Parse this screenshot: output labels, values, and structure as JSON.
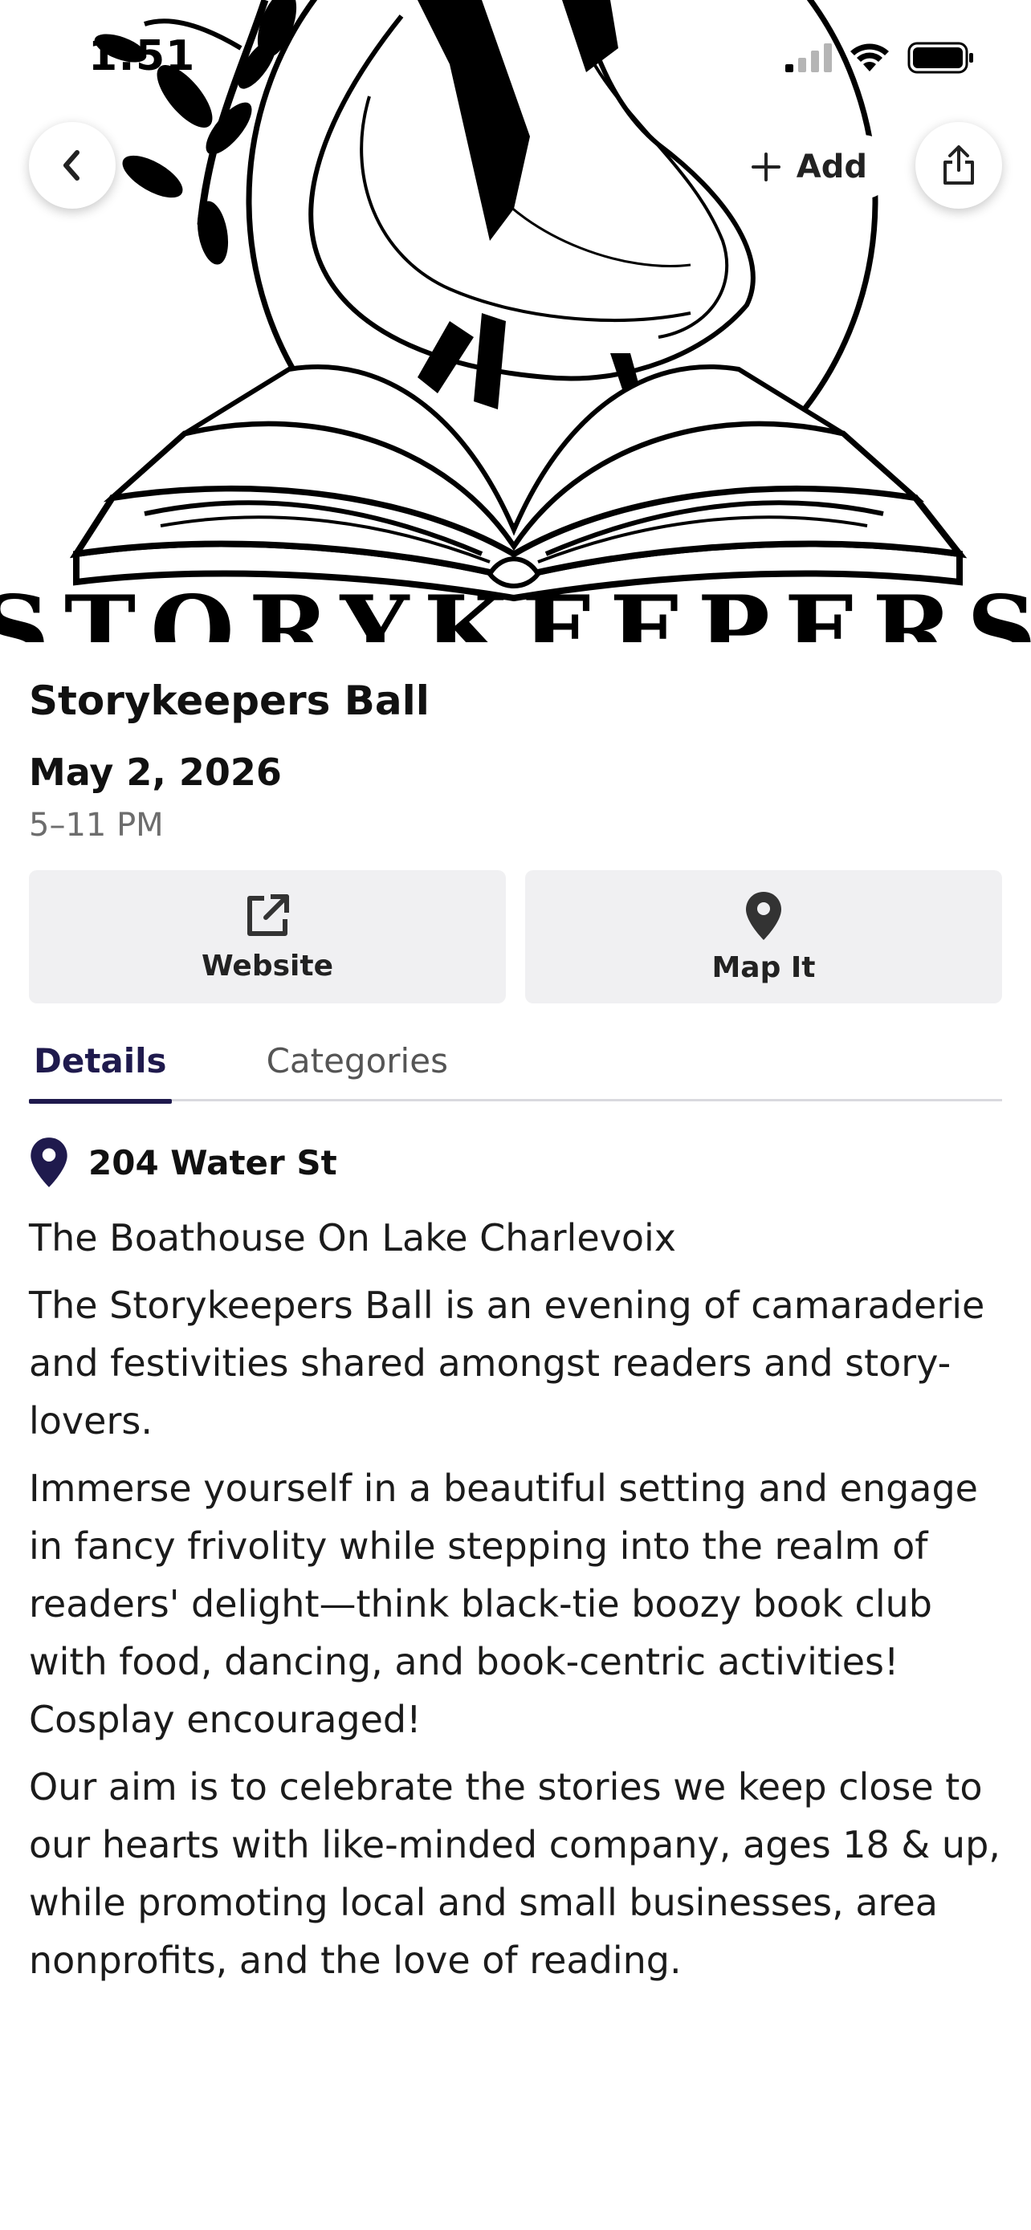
{
  "status_bar": {
    "time": "1:51"
  },
  "header": {
    "add_label": "Add"
  },
  "hero": {
    "banner_text": "STORYKEEPERS"
  },
  "event": {
    "title": "Storykeepers Ball",
    "date": "May 2, 2026",
    "time": "5–11 PM"
  },
  "actions": {
    "website_label": "Website",
    "map_label": "Map It"
  },
  "tabs": [
    {
      "label": "Details",
      "active": true
    },
    {
      "label": "Categories",
      "active": false
    }
  ],
  "details": {
    "address": "204 Water St",
    "venue": "The Boathouse On Lake Charlevoix",
    "paragraphs": [
      "The Storykeepers Ball is an evening of camaraderie and festivities shared amongst readers and story-lovers.",
      "Immerse yourself in a beautiful setting and engage in fancy frivolity while stepping into the realm of readers' delight—think black-tie boozy book club with food, dancing, and book-centric activities! Cosplay encouraged!",
      "Our aim is to celebrate the stories we keep close to our hearts with like-minded company, ages 18 & up, while promoting local and small businesses, area nonprofits, and the love of reading."
    ]
  },
  "colors": {
    "accent": "#1f1a4d",
    "button_bg": "#f0f0f2",
    "muted_text": "#6d6d6d"
  }
}
